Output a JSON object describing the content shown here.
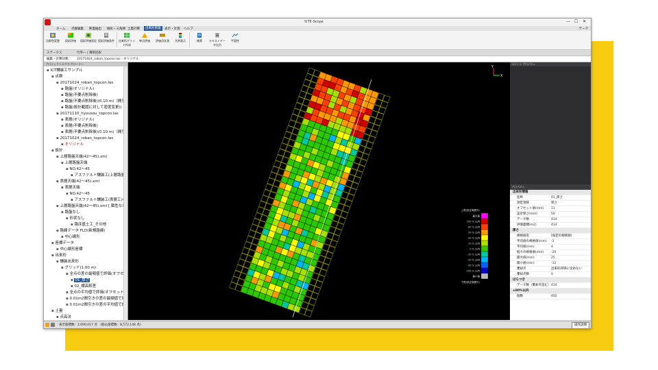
{
  "app": {
    "title": "SiTE-Scope",
    "win_buttons": [
      "—",
      "☐",
      "✕"
    ]
  },
  "menu": {
    "items": [
      "ホーム",
      "点群編集",
      "断面抽出",
      "線形・三角網",
      "土量計算",
      "出来形管理",
      "表示・計測",
      "ヘルプ"
    ],
    "active_index": 5,
    "right_label": "テーマ"
  },
  "ribbon": {
    "buttons": [
      "点群色変更",
      "段彩評価",
      "段彩評価設定",
      "段彩評価条件",
      "出来形グリッド作成",
      "単点評価",
      "評価点計測",
      "凡例表示",
      "帳票",
      "テキストデータ出力",
      "平面性"
    ]
  },
  "status_row": {
    "label": "ステータス",
    "value": "行単一 | 薄明読択"
  },
  "path_row": {
    "label": "編集・計算対象：",
    "value": "20171024_roban_topcon.las ‐ オリジナル"
  },
  "left_panel": {
    "title": "プロジェクトエクスプローラー",
    "tree": [
      {
        "text": "ICT舗装工サンプル",
        "level": 0
      },
      {
        "text": "点群",
        "level": 1
      },
      {
        "text": "20171024_roban_topcon.las",
        "level": 2
      },
      {
        "text": "路盤(オリジナル)",
        "level": 3
      },
      {
        "text": "路盤(不要点削除後)",
        "level": 3
      },
      {
        "text": "路盤(不要点削除後)(0.10 m)（間引",
        "level": 3
      },
      {
        "text": "路盤(設計範囲に対して密度変更)(",
        "level": 3
      },
      {
        "text": "20171110_hyousou_topcon.las",
        "level": 2
      },
      {
        "text": "表層(オリジナル)",
        "level": 3
      },
      {
        "text": "表層(不要点削除後)",
        "level": 3
      },
      {
        "text": "表層(不要点削除後)(0.10 m)（間引",
        "level": 3
      },
      {
        "text": "20171024_roban_topcon.las",
        "level": 2
      },
      {
        "text": "オリジナル",
        "level": 3,
        "red": true
      },
      {
        "text": "設計",
        "level": 1
      },
      {
        "text": "上層路盤天端(42〜45).xml",
        "level": 2
      },
      {
        "text": "上層路盤天端",
        "level": 3
      },
      {
        "text": "NO.42〜45",
        "level": 4
      },
      {
        "text": "アスファルト舗装工(上層路盤工",
        "level": 5
      },
      {
        "text": "表層天端(42〜45).xml",
        "level": 2
      },
      {
        "text": "表層天端",
        "level": 3
      },
      {
        "text": "NO.42〜45",
        "level": 4
      },
      {
        "text": "アスファルト舗装工(表層工)小規",
        "level": 5
      },
      {
        "text": "上層路盤天端(42〜45).xml [ 属性なし",
        "level": 2
      },
      {
        "text": "路盤なし",
        "level": 3
      },
      {
        "text": "形状なし",
        "level": 4
      },
      {
        "text": "路床盛土工_その他",
        "level": 5
      },
      {
        "text": "路線データ FLD(新規路線)",
        "level": 2
      },
      {
        "text": "中心線形",
        "level": 3
      },
      {
        "text": "座標データ",
        "level": 1
      },
      {
        "text": "中心線形座標",
        "level": 2
      },
      {
        "text": "出来形",
        "level": 1
      },
      {
        "text": "舗装出来形",
        "level": 2
      },
      {
        "text": "グリッド(1.00 m)",
        "level": 3
      },
      {
        "text": "全点の差の最頻値で評価(オフセット",
        "level": 4
      },
      {
        "text": "01_厚さ",
        "level": 5,
        "selected": true
      },
      {
        "text": "02_標高較差",
        "level": 5
      },
      {
        "text": "全点の平均値で評価(オフセット1",
        "level": 4
      },
      {
        "text": "0.01m2間引きの差の最頻値で評価",
        "level": 4
      },
      {
        "text": "0.01m2間引きの差の平均値で評価(オ",
        "level": 4
      },
      {
        "text": "土量",
        "level": 1
      },
      {
        "text": "点高法",
        "level": 2
      }
    ]
  },
  "viewport": {
    "axis_y": "Y",
    "axis_x": "X",
    "legend": {
      "title_top": "上限(設定範囲外)",
      "entries": [
        {
          "label": "最大値",
          "color": "#ff00ff"
        },
        {
          "label": "100 % 以内",
          "color": "#d40000"
        },
        {
          "label": "80 % 以内",
          "color": "#ff4000"
        },
        {
          "label": "50 % 以内",
          "color": "#ff9900"
        },
        {
          "label": "30 % 以内",
          "color": "#ffff00"
        },
        {
          "label": "10 % 以内",
          "color": "#a8e000"
        },
        {
          "label": "0 % 以内",
          "color": "#2cc800"
        },
        {
          "label": "-10 % 以内",
          "color": "#00c8a0"
        },
        {
          "label": "-30 % 以内",
          "color": "#00b4ff"
        },
        {
          "label": "-50 % 以内",
          "color": "#0064ff"
        },
        {
          "label": "-100 % 以内",
          "color": "#0000c8"
        },
        {
          "label": "最小値",
          "color": "#bbbbbb"
        }
      ],
      "title_bottom": "下限(設定範囲外)"
    }
  },
  "right_panel": {
    "title_top": "コメントプロパティ",
    "title_props": "プロパティ",
    "rows": [
      {
        "k": "出来形情報",
        "v": "",
        "section": true
      },
      {
        "k": "名称",
        "v": "01_厚さ"
      },
      {
        "k": "測定項目",
        "v": "厚さ"
      },
      {
        "k": "オフセット値(mm)",
        "v": "11"
      },
      {
        "k": "設計厚さ(mm)",
        "v": "50"
      },
      {
        "k": "データ数",
        "v": "414"
      },
      {
        "k": "評価面積(m2)",
        "v": "414"
      },
      {
        "k": "厚さ",
        "v": "",
        "section": true
      },
      {
        "k": "規格値名",
        "v": "[既定の規格値]"
      },
      {
        "k": "平均値の規格値(mm)",
        "v": "-3"
      },
      {
        "k": "平均値(mm)",
        "v": "4"
      },
      {
        "k": "個々の規格値(mm)",
        "v": "-20"
      },
      {
        "k": "最大値(mm)",
        "v": "25"
      },
      {
        "k": "最小値(mm)",
        "v": "-12"
      },
      {
        "k": "棄却点",
        "v": "出来形評価に含めない"
      },
      {
        "k": "棄却点数",
        "v": "0"
      },
      {
        "k": "ばらつき",
        "v": "",
        "section": true
      },
      {
        "k": "データ数（棄却点含む）",
        "v": "414"
      },
      {
        "k": "±80%以内",
        "v": "",
        "section": true
      },
      {
        "k": "個数",
        "v": "402"
      }
    ]
  },
  "bottom_bar": {
    "stats": "表示座標数：2,690,017 点　(取込座標数：8,572,148 点)",
    "help_button": "操作説明"
  }
}
